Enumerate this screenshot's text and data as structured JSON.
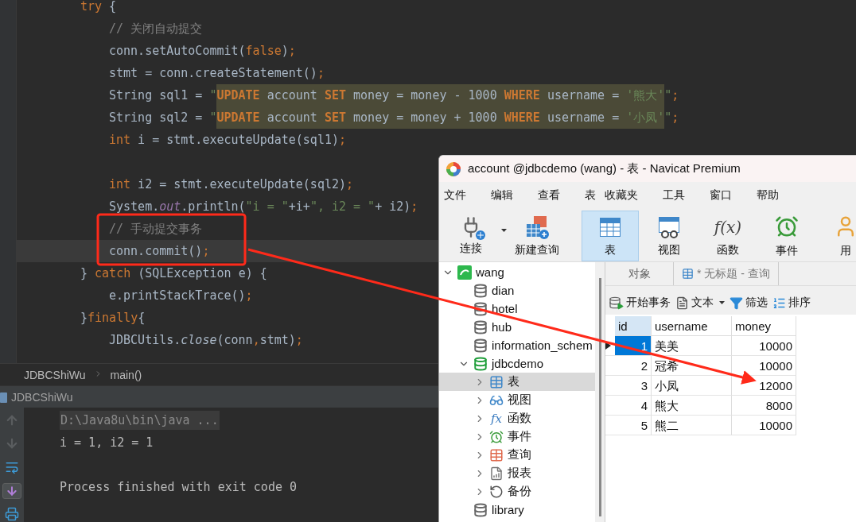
{
  "editor": {
    "lines": [
      {
        "tokens": [
          {
            "kind": "kw",
            "text": "try"
          },
          {
            "kind": "plain",
            "text": " {"
          }
        ],
        "children": [
          {
            "tokens": [
              {
                "kind": "comment",
                "text": "// 关闭自动提交"
              }
            ]
          },
          {
            "tokens": [
              {
                "kind": "plain",
                "text": "conn.setAutoCommit("
              },
              {
                "kind": "kw",
                "text": "false"
              },
              {
                "kind": "plain",
                "text": ")"
              },
              {
                "kind": "punct",
                "text": ";"
              }
            ]
          },
          {
            "tokens": [
              {
                "kind": "plain",
                "text": "stmt = conn.createStatement()"
              },
              {
                "kind": "punct",
                "text": ";"
              }
            ]
          },
          {
            "tokens": [
              {
                "kind": "plain",
                "text": "String sql1 = "
              },
              {
                "kind": "str",
                "text": "\""
              },
              {
                "kind": "sqlkw",
                "text": "UPDATE"
              },
              {
                "kind": "sql",
                "text": " account "
              },
              {
                "kind": "sqlkw",
                "text": "SET"
              },
              {
                "kind": "sql",
                "text": " money = money - 1000 "
              },
              {
                "kind": "sqlkw",
                "text": "WHERE"
              },
              {
                "kind": "sql",
                "text": " username = "
              },
              {
                "kind": "sqlstr",
                "text": "'熊大'"
              },
              {
                "kind": "str",
                "text": "\""
              },
              {
                "kind": "punct",
                "text": ";"
              }
            ]
          },
          {
            "tokens": [
              {
                "kind": "plain",
                "text": "String sql2 = "
              },
              {
                "kind": "str",
                "text": "\""
              },
              {
                "kind": "sqlkw",
                "text": "UPDATE"
              },
              {
                "kind": "sql",
                "text": " account "
              },
              {
                "kind": "sqlkw",
                "text": "SET"
              },
              {
                "kind": "sql",
                "text": " money = money + 1000 "
              },
              {
                "kind": "sqlkw",
                "text": "WHERE"
              },
              {
                "kind": "sql",
                "text": " username = "
              },
              {
                "kind": "sqlstr",
                "text": "'小凤'"
              },
              {
                "kind": "str",
                "text": "\""
              },
              {
                "kind": "punct",
                "text": ";"
              }
            ]
          },
          {
            "tokens": [
              {
                "kind": "kw",
                "text": "int"
              },
              {
                "kind": "plain",
                "text": " i = stmt.executeUpdate(sql1)"
              },
              {
                "kind": "punct",
                "text": ";"
              }
            ]
          },
          {
            "kind": "blank"
          },
          {
            "tokens": [
              {
                "kind": "kw",
                "text": "int"
              },
              {
                "kind": "plain",
                "text": " i2 = stmt.executeUpdate(sql2)"
              },
              {
                "kind": "punct",
                "text": ";"
              }
            ]
          },
          {
            "tokens": [
              {
                "kind": "plain",
                "text": "System."
              },
              {
                "kind": "field",
                "text": "out"
              },
              {
                "kind": "plain",
                "text": ".println("
              },
              {
                "kind": "str",
                "text": "\"i = \""
              },
              {
                "kind": "plain",
                "text": "+i+"
              },
              {
                "kind": "str",
                "text": "\", i2 = \""
              },
              {
                "kind": "plain",
                "text": "+ i2)"
              },
              {
                "kind": "punct",
                "text": ";"
              }
            ]
          },
          {
            "tokens": [
              {
                "kind": "comment",
                "text": "// 手动提交事务"
              }
            ]
          },
          {
            "current": true,
            "tokens": [
              {
                "kind": "plain",
                "text": "conn.commit()"
              },
              {
                "kind": "punct",
                "text": ";"
              }
            ]
          }
        ]
      },
      {
        "tokens": [
          {
            "kind": "plain",
            "text": "} "
          },
          {
            "kind": "kw",
            "text": "catch"
          },
          {
            "kind": "plain",
            "text": " (SQLException e) {"
          }
        ],
        "children": [
          {
            "tokens": [
              {
                "kind": "plain",
                "text": "e.printStackTrace()"
              },
              {
                "kind": "punct",
                "text": ";"
              }
            ]
          }
        ]
      },
      {
        "tokens": [
          {
            "kind": "plain",
            "text": "}"
          },
          {
            "kind": "kw",
            "text": "finally"
          },
          {
            "kind": "plain",
            "text": "{"
          }
        ],
        "children": [
          {
            "tokens": [
              {
                "kind": "plain",
                "text": "JDBCUtils."
              },
              {
                "kind": "static",
                "text": "close"
              },
              {
                "kind": "plain",
                "text": "(conn"
              },
              {
                "kind": "punct",
                "text": ","
              },
              {
                "kind": "plain",
                "text": "stmt)"
              },
              {
                "kind": "punct",
                "text": ";"
              }
            ]
          }
        ]
      }
    ]
  },
  "breadcrumb": [
    "JDBCShiWu",
    "main()"
  ],
  "run_tab": {
    "label": "JDBCShiWu"
  },
  "console": {
    "lines": [
      {
        "kind": "command",
        "text": "D:\\Java8u\\bin\\java ..."
      },
      {
        "kind": "output",
        "text": "i = 1, i2 = 1"
      },
      {
        "kind": "blank"
      },
      {
        "kind": "output",
        "text": "Process finished with exit code 0"
      }
    ]
  },
  "navicat": {
    "title": "account @jdbcdemo (wang) - 表 - Navicat Premium",
    "menu": [
      "文件",
      "编辑",
      "查看",
      "表",
      "收藏夹",
      "工具",
      "窗口",
      "帮助"
    ],
    "toolbar": [
      {
        "kind": "connect",
        "label": "连接",
        "selected": false
      },
      {
        "kind": "query",
        "label": "新建查询",
        "selected": false
      },
      {
        "kind": "table",
        "label": "表",
        "selected": true
      },
      {
        "kind": "view",
        "label": "视图",
        "selected": false
      },
      {
        "kind": "function",
        "glyph": "f(x)",
        "label": "函数",
        "selected": false
      },
      {
        "kind": "event",
        "label": "事件",
        "selected": false
      },
      {
        "kind": "user",
        "label": "用",
        "selected": false
      }
    ],
    "tree": [
      {
        "kind": "server",
        "label": "wang",
        "expanded": true,
        "selected": false,
        "children": [
          {
            "kind": "database",
            "label": "dian",
            "selected": false
          },
          {
            "kind": "database",
            "label": "hotel",
            "selected": false
          },
          {
            "kind": "database",
            "label": "hub",
            "selected": false
          },
          {
            "kind": "database",
            "label": "information_schem",
            "selected": false
          },
          {
            "kind": "database",
            "label": "jdbcdemo",
            "expanded": true,
            "selected": false,
            "children": [
              {
                "kind": "table",
                "label": "表",
                "expanded": false,
                "selected": true
              },
              {
                "kind": "view",
                "label": "视图",
                "expanded": false,
                "selected": false
              },
              {
                "kind": "function",
                "glyph": "fx",
                "label": "函数",
                "expanded": false,
                "selected": false
              },
              {
                "kind": "event",
                "label": "事件",
                "expanded": false,
                "selected": false
              },
              {
                "kind": "query",
                "label": "查询",
                "expanded": false,
                "selected": false
              },
              {
                "kind": "report",
                "label": "报表",
                "expanded": false,
                "selected": false
              },
              {
                "kind": "backup",
                "label": "备份",
                "expanded": false,
                "selected": false
              }
            ]
          },
          {
            "kind": "database",
            "label": "library",
            "selected": false
          }
        ]
      }
    ],
    "tabs": [
      {
        "label": "对象",
        "selected": false
      },
      {
        "label": "* 无标题 - 查询",
        "selected": true
      }
    ],
    "grid_toolbar": [
      {
        "kind": "transaction",
        "label": "开始事务"
      },
      {
        "kind": "text",
        "label": "文本"
      },
      {
        "kind": "filter",
        "label": "筛选"
      },
      {
        "kind": "sort",
        "label": "排序"
      }
    ],
    "table": {
      "columns": [
        "id",
        "username",
        "money"
      ],
      "rows": [
        {
          "cells": [
            "1",
            "美美",
            "10000"
          ],
          "selected": true
        },
        {
          "cells": [
            "2",
            "冠希",
            "10000"
          ],
          "selected": false
        },
        {
          "cells": [
            "3",
            "小凤",
            "12000"
          ],
          "selected": false
        },
        {
          "cells": [
            "4",
            "熊大",
            "8000"
          ],
          "selected": false
        },
        {
          "cells": [
            "5",
            "熊二",
            "10000"
          ],
          "selected": false
        }
      ]
    }
  }
}
